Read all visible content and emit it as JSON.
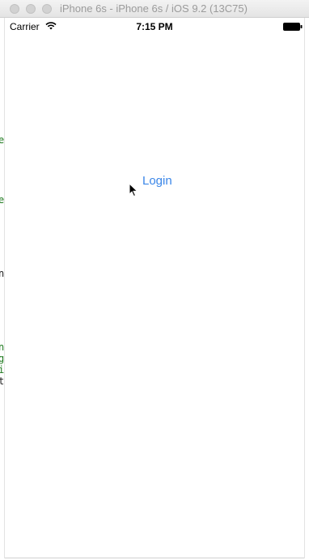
{
  "window": {
    "title": "iPhone 6s - iPhone 6s / iOS 9.2 (13C75)"
  },
  "status_bar": {
    "carrier": "Carrier",
    "time": "7:15 PM",
    "wifi_icon": "wifi-icon",
    "battery_icon": "battery-icon"
  },
  "main": {
    "login_label": "Login",
    "accent_color": "#3a86e8"
  },
  "edge_glyphs": [
    "e",
    "e",
    "n",
    "n",
    "g",
    "i",
    "t"
  ]
}
